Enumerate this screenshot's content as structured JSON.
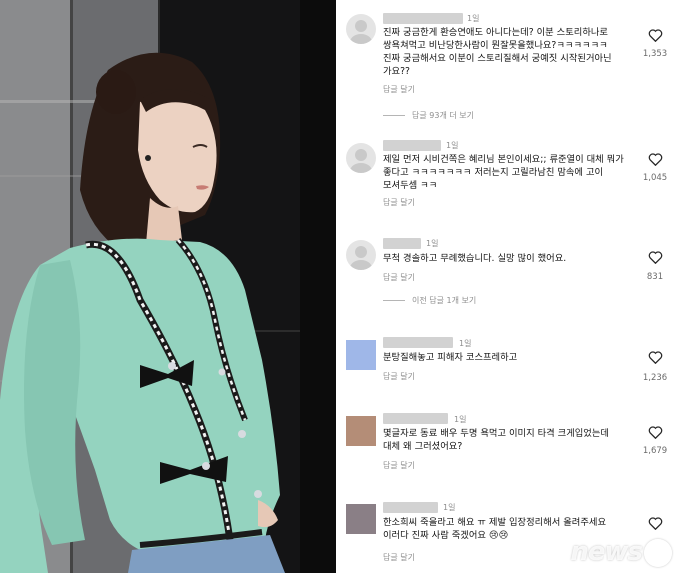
{
  "comments": [
    {
      "time": "1일",
      "text": "진짜 궁금한게 환승연애도 아니다는데? 이분 스토리하나로\n쌍욕쳐먹고 비난당한사람이 뭔잘못을했나요?ㅋㅋㅋㅋㅋㅋ\n진짜 궁금해서요 이분이 스토리질해서 궁예짓 시작된거아닌\n가요??",
      "reply_label": "답글 달기",
      "likes": "1,353",
      "more_replies": "답글 93개 더 보기"
    },
    {
      "time": "1일",
      "text": "제일 먼저 시비건쪽은 혜리님 본인이세요;; 류준열이 대체 뭐가\n좋다고 ㅋㅋㅋㅋㅋㅋㅋ 저러는지 고릴라남친 맘속에 고이\n모셔두셈 ㅋㅋ",
      "reply_label": "답글 달기",
      "likes": "1,045"
    },
    {
      "time": "1일",
      "text": "무척 경솔하고 무례했습니다. 실망 많이 했어요.",
      "reply_label": "답글 달기",
      "likes": "831",
      "more_replies": "이전 답글 1개 보기"
    },
    {
      "time": "1일",
      "text": "분탕질해놓고 피해자 코스프레하고",
      "reply_label": "답글 달기",
      "likes": "1,236",
      "avatar_color": "#9fb7e8"
    },
    {
      "time": "1일",
      "text": "몇글자로 동료 배우 두명 욕먹고 이미지 타격 크게입었는데\n대체 왜 그러셨어요?",
      "reply_label": "답글 달기",
      "likes": "1,679",
      "avatar_color": "#b48d77"
    },
    {
      "time": "1일",
      "text": "한소희씨 죽을라고 해요 ㅠ 제발 입장정리해서 올려주세요\n이러다 진짜 사람 죽겠어요 😢😢",
      "reply_label": "답글 달기",
      "likes": "",
      "avatar_color": "#8a7f86"
    }
  ],
  "watermark": {
    "text": "news",
    "number": "1"
  },
  "icons": {
    "like": "heart-icon",
    "avatar": "avatar-icon"
  }
}
